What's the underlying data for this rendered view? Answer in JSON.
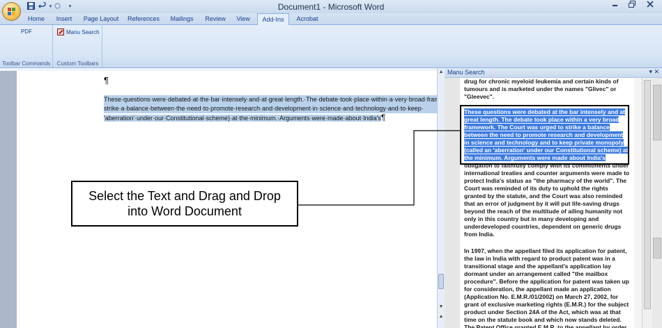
{
  "window": {
    "title": "Document1 - Microsoft Word",
    "qat_icons": [
      "save-icon",
      "undo-icon",
      "redo-icon",
      "customize-qat-icon"
    ],
    "controls": [
      "minimize-icon",
      "maximize-icon",
      "close-icon"
    ]
  },
  "tabs": [
    "Home",
    "Insert",
    "Page Layout",
    "References",
    "Mailings",
    "Review",
    "View",
    "Add-Ins",
    "Acrobat"
  ],
  "active_tab": "Add-Ins",
  "ribbon": {
    "groups": [
      {
        "label": "Toolbar Commands",
        "buttons": [
          "PDF"
        ]
      },
      {
        "label": "Custom Toolbars",
        "buttons": [
          "Manu Search"
        ]
      }
    ]
  },
  "document": {
    "paragraph_mark": "¶",
    "lines": [
      "These·questions·were·debated·at·the·bar·intensely·and·at·great·length.·The·debate·took·place·within·a·very·broad·framew",
      "strike·a·balance·between·the·need·to·promote·research·and·development·in·science·and·technology·and·to·keep·",
      "'aberration'·under·our·Constitutional·scheme)·at·the·minimum.·Arguments·were·made·about·India's"
    ],
    "end_mark": "¶"
  },
  "callout": {
    "line1": "Select the Text and Drag and Drop",
    "line2": "into Word Document"
  },
  "pane": {
    "title": "Manu Search",
    "buttons": "▾ ✕",
    "top_text": "drug for chronic myeloid leukemia and certain kinds of tumours and is marketed under the names \"Glivec\" or \"Gleevec\".",
    "highlighted": "These questions were debated at the bar intensely and at great length. The debate took place within a very broad framework. The Court was urged to strike a balance between the need to promote research and development in science and technology and to keep private monopoly (called an 'aberration' under our Constitutional scheme) at the minimum. Arguments were made about India's",
    "para1_rest": "obligation to faithfully comply with its commitments under international treaties and counter arguments were made to protect India's status as \"the pharmacy of the world\". The Court was reminded of its duty to uphold the rights granted by the statute, and the Court was also reminded that an error of judgment by it will put life-saving drugs beyond the reach of the multitude of ailing humanity not only in this country but in many developing and underdeveloped countries, dependent on generic drugs from India.",
    "para2": "In 1997, when the appellant filed its application for patent, the law in India with regard to product patent was in a transitional stage and the appellant's application lay dormant under an arrangement called \"the mailbox procedure\". Before the application for patent was taken up for consideration, the appellant made an application (Application No. E.M.R./01/2002) on March 27, 2002, for grant of exclusive marketing rights (E.M.R.) for the subject product under Section 24A of the Act, which was at that time on the statute book and which now stands deleted. The Patent Office granted E.M.R. to the appellant by order"
  },
  "side_labels": {
    "fragment": "rop",
    "fragment2": "ion"
  }
}
